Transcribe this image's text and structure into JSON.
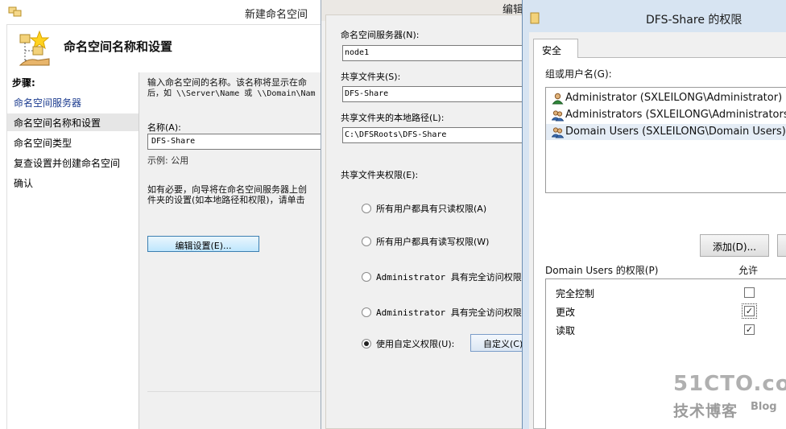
{
  "wizard": {
    "title": "新建命名空间",
    "header_title": "命名空间名称和设置",
    "steps_heading": "步骤:",
    "steps": [
      {
        "label": "命名空间服务器",
        "state": "link"
      },
      {
        "label": "命名空间名称和设置",
        "state": "current"
      },
      {
        "label": "命名空间类型",
        "state": "normal"
      },
      {
        "label": "复查设置并创建命名空间",
        "state": "normal"
      },
      {
        "label": "确认",
        "state": "normal"
      }
    ],
    "description_line1": "输入命名空间的名称。该名称将显示在命",
    "description_line2": "后，如 \\\\Server\\Name 或 \\\\Domain\\Nam",
    "name_label": "名称(A):",
    "name_value": "DFS-Share",
    "example": "示例: 公用",
    "hint_line1": "如有必要，向导将在命名空间服务器上创",
    "hint_line2": "件夹的设置(如本地路径和权限)，请单击",
    "edit_button": "编辑设置(E)..."
  },
  "edit_settings": {
    "title": "编辑设置",
    "server_label": "命名空间服务器(N):",
    "server_value": "node1",
    "share_label": "共享文件夹(S):",
    "share_value": "DFS-Share",
    "local_path_label": "共享文件夹的本地路径(L):",
    "local_path_value": "C:\\DFSRoots\\DFS-Share",
    "perms_label": "共享文件夹权限(E):",
    "options": [
      {
        "label": "所有用户都具有只读权限(A)",
        "selected": false
      },
      {
        "label": "所有用户都具有读写权限(W)",
        "selected": false
      },
      {
        "label": "Administrator 具有完全访问权限;",
        "selected": false
      },
      {
        "label": "Administrator 具有完全访问权限;",
        "selected": false
      },
      {
        "label": "使用自定义权限(U):",
        "selected": true
      }
    ],
    "custom_button": "自定义(C)..."
  },
  "permissions": {
    "title": "DFS-Share 的权限",
    "tab": "安全",
    "group_label": "组或用户名(G):",
    "users": [
      {
        "name": "Administrator (SXLEILONG\\Administrator)",
        "icon": "user-icon",
        "selected": false
      },
      {
        "name": "Administrators (SXLEILONG\\Administrators)",
        "icon": "group-icon",
        "selected": false
      },
      {
        "name": "Domain Users (SXLEILONG\\Domain Users)",
        "icon": "group-icon",
        "selected": true
      }
    ],
    "add_button": "添加(D)...",
    "perm_for_label": "Domain Users 的权限(P)",
    "allow_header": "允许",
    "perms": [
      {
        "name": "完全控制",
        "allow": false
      },
      {
        "name": "更改",
        "allow": true
      },
      {
        "name": "读取",
        "allow": true
      }
    ]
  },
  "watermark": {
    "site": "51CTO.com",
    "sub": "技术博客",
    "blog": "Blog"
  }
}
